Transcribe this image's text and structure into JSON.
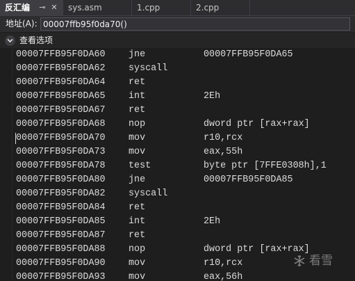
{
  "tabs": [
    {
      "label": "反汇编",
      "active": true,
      "pin_glyph": "⊸",
      "close_glyph": "✕"
    },
    {
      "label": "sys.asm",
      "active": false
    },
    {
      "label": "1.cpp",
      "active": false
    },
    {
      "label": "2.cpp",
      "active": false
    }
  ],
  "address": {
    "label": "地址(A):",
    "value": "00007ffb95f0da70()"
  },
  "options": {
    "label": "查看选项",
    "icon": "chevron-down-icon"
  },
  "rows": [
    {
      "addr": "00007FFB95F0DA60",
      "mnemonic": "jne",
      "operands": "00007FFB95F0DA65"
    },
    {
      "addr": "00007FFB95F0DA62",
      "mnemonic": "syscall",
      "operands": ""
    },
    {
      "addr": "00007FFB95F0DA64",
      "mnemonic": "ret",
      "operands": ""
    },
    {
      "addr": "00007FFB95F0DA65",
      "mnemonic": "int",
      "operands": "2Eh"
    },
    {
      "addr": "00007FFB95F0DA67",
      "mnemonic": "ret",
      "operands": ""
    },
    {
      "addr": "00007FFB95F0DA68",
      "mnemonic": "nop",
      "operands": "dword ptr [rax+rax]"
    },
    {
      "addr": "00007FFB95F0DA70",
      "mnemonic": "mov",
      "operands": "r10,rcx"
    },
    {
      "addr": "00007FFB95F0DA73",
      "mnemonic": "mov",
      "operands": "eax,55h"
    },
    {
      "addr": "00007FFB95F0DA78",
      "mnemonic": "test",
      "operands": "byte ptr [7FFE0308h],1"
    },
    {
      "addr": "00007FFB95F0DA80",
      "mnemonic": "jne",
      "operands": "00007FFB95F0DA85"
    },
    {
      "addr": "00007FFB95F0DA82",
      "mnemonic": "syscall",
      "operands": ""
    },
    {
      "addr": "00007FFB95F0DA84",
      "mnemonic": "ret",
      "operands": ""
    },
    {
      "addr": "00007FFB95F0DA85",
      "mnemonic": "int",
      "operands": "2Eh"
    },
    {
      "addr": "00007FFB95F0DA87",
      "mnemonic": "ret",
      "operands": ""
    },
    {
      "addr": "00007FFB95F0DA88",
      "mnemonic": "nop",
      "operands": "dword ptr [rax+rax]"
    },
    {
      "addr": "00007FFB95F0DA90",
      "mnemonic": "mov",
      "operands": "r10,rcx"
    },
    {
      "addr": "00007FFB95F0DA93",
      "mnemonic": "mov",
      "operands": "eax,56h"
    }
  ],
  "watermark": {
    "text": "看雪",
    "icon": "kanxue-logo-icon"
  },
  "colors": {
    "background": "#1e1e1e",
    "tab_active": "#3e3e42",
    "text": "#dcdcdc"
  }
}
